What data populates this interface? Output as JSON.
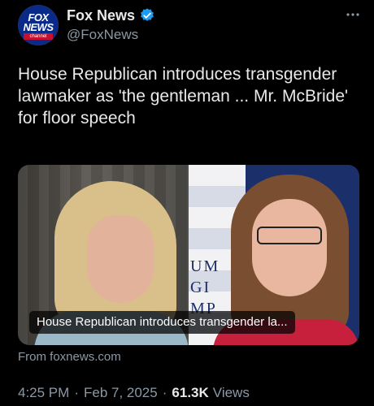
{
  "author": {
    "name": "Fox News",
    "handle": "@FoxNews",
    "avatar_lines": [
      "FOX",
      "NEWS",
      "channel"
    ],
    "verified_color": "#1d9bf0"
  },
  "more_icon": "more-horizontal-icon",
  "tweet": {
    "text": "House Republican introduces transgender lawmaker as 'the gentleman ... Mr. McBride' for floor speech"
  },
  "card": {
    "caption": "House Republican introduces transgender la...",
    "source": "From foxnews.com",
    "backdrop_letters": "UM\nGI\nMP"
  },
  "meta": {
    "time": "4:25 PM",
    "date": "Feb 7, 2025",
    "views_count": "61.3K",
    "views_label": "Views"
  }
}
